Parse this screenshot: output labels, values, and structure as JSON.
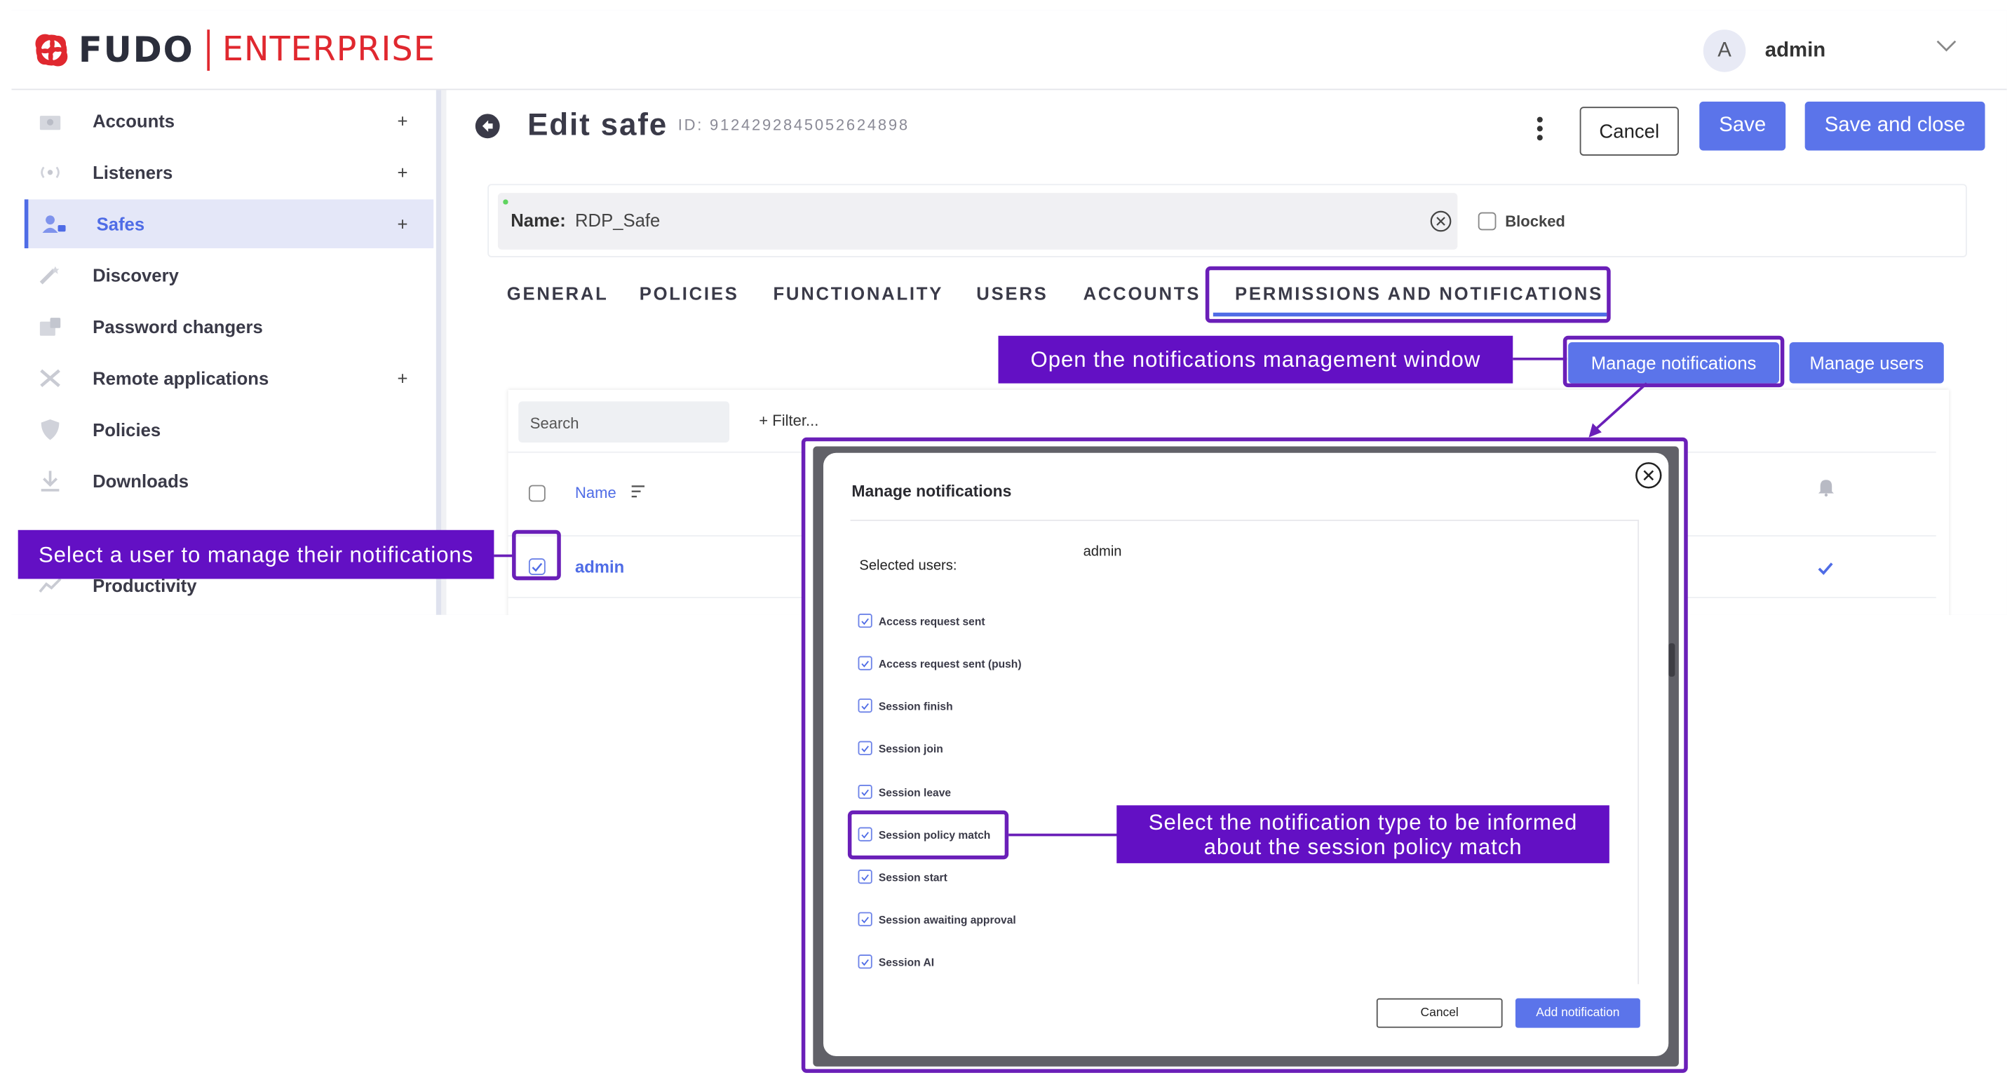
{
  "app": {
    "logo_word": "FUDO",
    "logo_edition": "ENTERPRISE",
    "user": {
      "initial": "A",
      "name": "admin"
    }
  },
  "sidebar": {
    "items": [
      {
        "label": "Accounts",
        "icon": "accounts-icon",
        "has_plus": true,
        "active": false
      },
      {
        "label": "Listeners",
        "icon": "listeners-icon",
        "has_plus": true,
        "active": false
      },
      {
        "label": "Safes",
        "icon": "safes-icon",
        "has_plus": true,
        "active": true
      },
      {
        "label": "Discovery",
        "icon": "discovery-icon",
        "has_plus": false,
        "active": false
      },
      {
        "label": "Password changers",
        "icon": "password-changers-icon",
        "has_plus": false,
        "active": false
      },
      {
        "label": "Remote applications",
        "icon": "remote-applications-icon",
        "has_plus": true,
        "active": false
      },
      {
        "label": "Policies",
        "icon": "policies-icon",
        "has_plus": false,
        "active": false
      },
      {
        "label": "Downloads",
        "icon": "downloads-icon",
        "has_plus": false,
        "active": false
      },
      {
        "label": "Productivity",
        "icon": "productivity-icon",
        "has_plus": false,
        "active": false
      }
    ],
    "plus_symbol": "+"
  },
  "header": {
    "title": "Edit safe",
    "id_text": "ID: 9124292845052624898",
    "cancel_label": "Cancel",
    "save_label": "Save",
    "save_close_label": "Save and close"
  },
  "safe": {
    "name_label": "Name:",
    "name_value": "RDP_Safe",
    "blocked_label": "Blocked"
  },
  "tabs": [
    "GENERAL",
    "POLICIES",
    "FUNCTIONALITY",
    "USERS",
    "ACCOUNTS",
    "PERMISSIONS AND NOTIFICATIONS"
  ],
  "actions": {
    "manage_notifications": "Manage notifications",
    "manage_users": "Manage users"
  },
  "table": {
    "search_placeholder": "Search",
    "filter_label": "+ Filter...",
    "column_name": "Name",
    "rows": [
      {
        "name": "admin",
        "checked": true,
        "notified": true
      }
    ]
  },
  "modal": {
    "title": "Manage notifications",
    "selected_users_label": "Selected users:",
    "selected_users_value": "admin",
    "notifications": [
      "Access request sent",
      "Access request sent (push)",
      "Session finish",
      "Session join",
      "Session leave",
      "Session policy match",
      "Session start",
      "Session awaiting approval",
      "Session AI"
    ],
    "cancel_label": "Cancel",
    "add_label": "Add notification"
  },
  "callouts": {
    "open_window": "Open the notifications management window",
    "select_user": "Select a user to manage their notifications",
    "select_type_line1": "Select the notification type to be informed",
    "select_type_line2": "about the session policy match"
  },
  "colors": {
    "brand_red": "#e0282f",
    "accent_blue": "#5b74ea",
    "callout_purple": "#6310c4",
    "highlight_purple": "#6a1fb8"
  }
}
